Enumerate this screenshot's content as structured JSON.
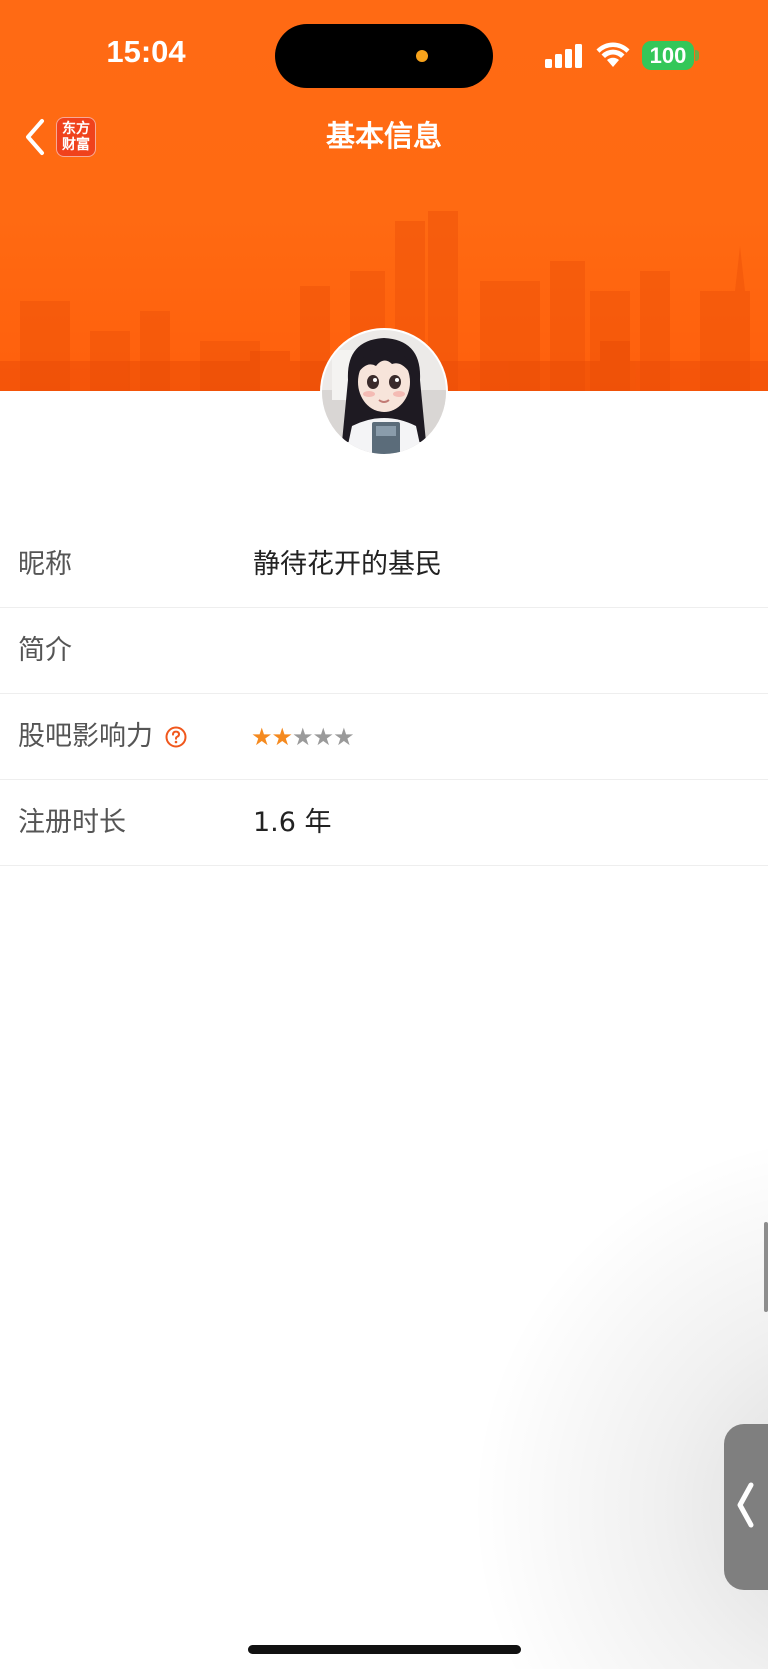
{
  "status_bar": {
    "time": "15:04",
    "battery": "100"
  },
  "nav": {
    "title": "基本信息",
    "brand_line1": "东方",
    "brand_line2": "财富"
  },
  "profile": {
    "rows": [
      {
        "label": "昵称",
        "value": "静待花开的基民"
      },
      {
        "label": "简介",
        "value": ""
      },
      {
        "label": "股吧影响力",
        "rating": 2,
        "rating_max": 5
      },
      {
        "label": "注册时长",
        "value": "1.6 年"
      }
    ]
  },
  "colors": {
    "header_orange": "#ff6a14",
    "star_active": "#f58a1f",
    "star_inactive": "#9a9a9a",
    "battery_green": "#34c759"
  }
}
